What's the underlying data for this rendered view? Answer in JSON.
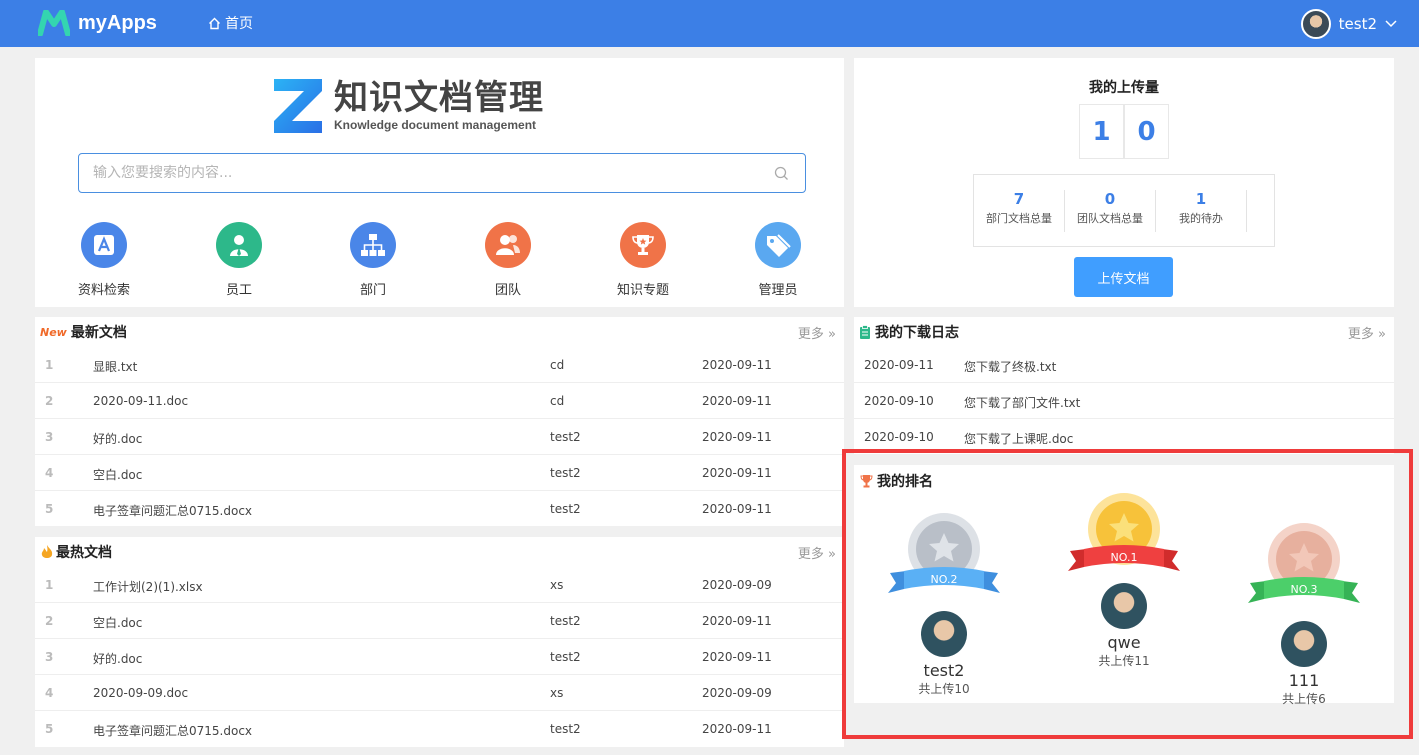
{
  "header": {
    "app_name": "myApps",
    "home_label": "首页",
    "username": "test2"
  },
  "brand": {
    "title": "知识文档管理",
    "subtitle": "Knowledge document management"
  },
  "search": {
    "placeholder": "输入您要搜索的内容...",
    "value": ""
  },
  "quick_links": [
    {
      "label": "资料检索",
      "color": "#4a86e8",
      "icon": "search-doc-icon"
    },
    {
      "label": "员工",
      "color": "#2db88a",
      "icon": "person-icon"
    },
    {
      "label": "部门",
      "color": "#4a86e8",
      "icon": "org-chart-icon"
    },
    {
      "label": "团队",
      "color": "#f07348",
      "icon": "team-icon"
    },
    {
      "label": "知识专题",
      "color": "#f07348",
      "icon": "trophy-icon"
    },
    {
      "label": "管理员",
      "color": "#5aa8f0",
      "icon": "tag-icon"
    }
  ],
  "upload": {
    "title": "我的上传量",
    "digits": [
      "1",
      "0"
    ],
    "stats": [
      {
        "value": "7",
        "label": "部门文档总量"
      },
      {
        "value": "0",
        "label": "团队文档总量"
      },
      {
        "value": "1",
        "label": "我的待办"
      }
    ],
    "button": "上传文档"
  },
  "newest": {
    "title": "最新文档",
    "badge": "New",
    "more": "更多",
    "rows": [
      {
        "idx": "1",
        "name": "显眼.txt",
        "user": "cd",
        "date": "2020-09-11"
      },
      {
        "idx": "2",
        "name": "2020-09-11.doc",
        "user": "cd",
        "date": "2020-09-11"
      },
      {
        "idx": "3",
        "name": "好的.doc",
        "user": "test2",
        "date": "2020-09-11"
      },
      {
        "idx": "4",
        "name": "空白.doc",
        "user": "test2",
        "date": "2020-09-11"
      },
      {
        "idx": "5",
        "name": "电子签章问题汇总0715.docx",
        "user": "test2",
        "date": "2020-09-11"
      }
    ]
  },
  "hottest": {
    "title": "最热文档",
    "more": "更多",
    "rows": [
      {
        "idx": "1",
        "name": "工作计划(2)(1).xlsx",
        "user": "xs",
        "date": "2020-09-09"
      },
      {
        "idx": "2",
        "name": "空白.doc",
        "user": "test2",
        "date": "2020-09-11"
      },
      {
        "idx": "3",
        "name": "好的.doc",
        "user": "test2",
        "date": "2020-09-11"
      },
      {
        "idx": "4",
        "name": "2020-09-09.doc",
        "user": "xs",
        "date": "2020-09-09"
      },
      {
        "idx": "5",
        "name": "电子签章问题汇总0715.docx",
        "user": "test2",
        "date": "2020-09-11"
      }
    ]
  },
  "downloads": {
    "title": "我的下载日志",
    "more": "更多",
    "rows": [
      {
        "date": "2020-09-11",
        "text": "您下载了终极.txt"
      },
      {
        "date": "2020-09-10",
        "text": "您下载了部门文件.txt"
      },
      {
        "date": "2020-09-10",
        "text": "您下载了上课呢.doc"
      }
    ]
  },
  "ranking": {
    "title": "我的排名",
    "entries": [
      {
        "badge": "NO.2",
        "name": "test2",
        "sub": "共上传10",
        "medal_color": "#b9bfc8",
        "ribbon_color": "#4aa3f0"
      },
      {
        "badge": "NO.1",
        "name": "qwe",
        "sub": "共上传11",
        "medal_color": "#f7c23a",
        "ribbon_color": "#ef4040"
      },
      {
        "badge": "NO.3",
        "name": "111",
        "sub": "共上传6",
        "medal_color": "#e7b09e",
        "ribbon_color": "#4ccf6a"
      }
    ]
  }
}
